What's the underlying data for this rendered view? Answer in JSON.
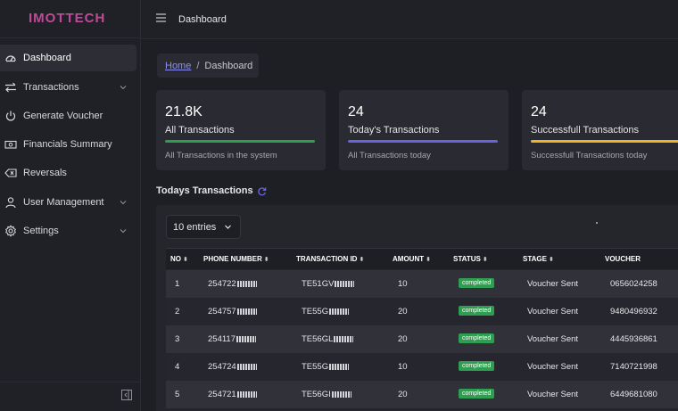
{
  "brand": "IMOTTECH",
  "topbar": {
    "title": "Dashboard"
  },
  "sidebar": {
    "items": [
      {
        "label": "Dashboard",
        "icon": "dashboard-icon",
        "active": true
      },
      {
        "label": "Transactions",
        "icon": "transfer-icon",
        "expandable": true
      },
      {
        "label": "Generate Voucher",
        "icon": "power-icon"
      },
      {
        "label": "Financials Summary",
        "icon": "money-icon"
      },
      {
        "label": "Reversals",
        "icon": "backspace-icon"
      },
      {
        "label": "User Management",
        "icon": "user-icon",
        "expandable": true
      },
      {
        "label": "Settings",
        "icon": "gear-icon",
        "expandable": true
      }
    ]
  },
  "breadcrumb": {
    "home": "Home",
    "separator": "/",
    "current": "Dashboard"
  },
  "cards": [
    {
      "value": "21.8K",
      "title": "All Transactions",
      "subtitle": "All Transactions in the system",
      "color": "#2f9e51"
    },
    {
      "value": "24",
      "title": "Today's Transactions",
      "subtitle": "All Transactions today",
      "color": "#6a63e0"
    },
    {
      "value": "24",
      "title": "Successfull Transactions",
      "subtitle": "Successfull Transactions today",
      "color": "#f0b429"
    }
  ],
  "section": {
    "title": "Todays Transactions"
  },
  "table": {
    "entries_label": "10 entries",
    "headers": [
      "NO",
      "PHONE NUMBER",
      "TRANSACTION ID",
      "AMOUNT",
      "STATUS",
      "STAGE",
      "VOUCHER"
    ],
    "rows": [
      {
        "no": "1",
        "phone": "254722",
        "txid": "TE51GV",
        "amount": "10",
        "status": "completed",
        "stage": "Voucher Sent",
        "voucher": "0656024258"
      },
      {
        "no": "2",
        "phone": "254757",
        "txid": "TE55G",
        "amount": "20",
        "status": "completed",
        "stage": "Voucher Sent",
        "voucher": "9480496932"
      },
      {
        "no": "3",
        "phone": "254117",
        "txid": "TE56GL",
        "amount": "20",
        "status": "completed",
        "stage": "Voucher Sent",
        "voucher": "4445936861"
      },
      {
        "no": "4",
        "phone": "254724",
        "txid": "TE55G",
        "amount": "10",
        "status": "completed",
        "stage": "Voucher Sent",
        "voucher": "7140721998"
      },
      {
        "no": "5",
        "phone": "254721",
        "txid": "TE56GI",
        "amount": "20",
        "status": "completed",
        "stage": "Voucher Sent",
        "voucher": "6449681080"
      }
    ]
  },
  "colors": {
    "accent": "#6a63e0",
    "brand": "#c04a9a",
    "success": "#2f9e51"
  }
}
